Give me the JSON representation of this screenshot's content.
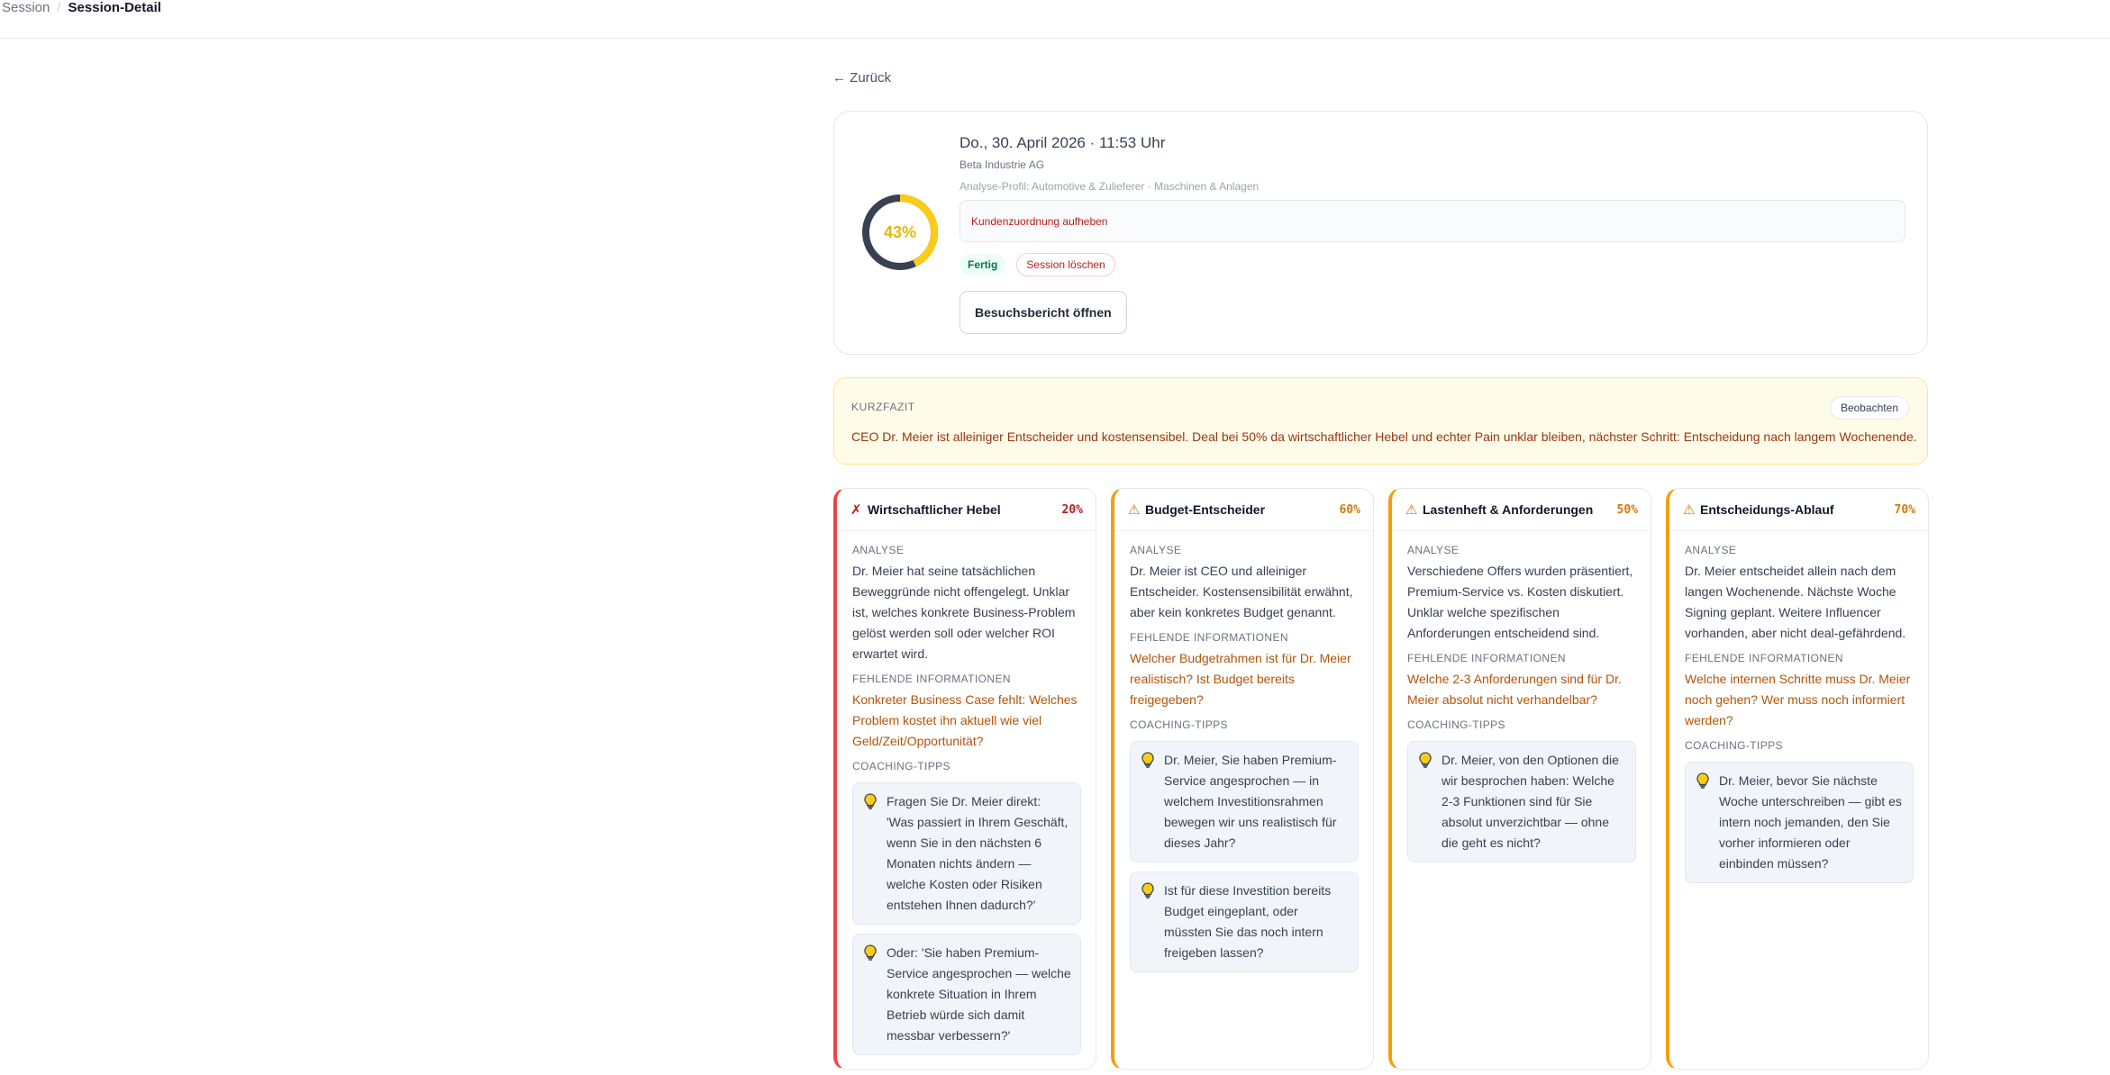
{
  "breadcrumb": {
    "parent": "Session",
    "separator": "/",
    "current": "Session-Detail"
  },
  "back_link": "← Zurück",
  "session": {
    "score_label": "43%",
    "score_value": 43,
    "date": "Do., 30. April 2026 · 11:53 Uhr",
    "customer": "Beta Industrie AG",
    "profile": "Analyse-Profil: Automotive & Zulieferer · Maschinen & Anlagen",
    "unassign_label": "Kundenzuordnung aufheben",
    "status": "Fertig",
    "delete_label": "Session löschen",
    "report_label": "Besuchsbericht öffnen"
  },
  "summary": {
    "title": "KURZFAZIT",
    "badge": "Beobachten",
    "text": "CEO Dr. Meier ist alleiniger Entscheider und kostensensibel. Deal bei 50% da wirtschaftlicher Hebel und echter Pain unklar bleiben, nächster Schritt: Entscheidung nach langem Wochenende."
  },
  "labels": {
    "analysis": "ANALYSE",
    "missing": "FEHLENDE INFORMATIONEN",
    "coaching": "COACHING-TIPPS"
  },
  "columns": [
    {
      "mark": "✗",
      "title": "Wirtschaftlicher Hebel",
      "percent": "20%",
      "analysis": "Dr. Meier hat seine tatsächlichen Beweggründe nicht offengelegt. Unklar ist, welches konkrete Business-Problem gelöst werden soll oder welcher ROI erwartet wird.",
      "missing": "Konkreter Business Case fehlt: Welches Problem kostet ihn aktuell wie viel Geld/Zeit/Opportunität?",
      "tips": [
        "Fragen Sie Dr. Meier direkt: 'Was passiert in Ihrem Geschäft, wenn Sie in den nächsten 6 Monaten nichts ändern — welche Kosten oder Risiken entstehen Ihnen dadurch?'",
        "Oder: 'Sie haben Premium-Service angesprochen — welche konkrete Situation in Ihrem Betrieb würde sich damit messbar verbessern?'"
      ]
    },
    {
      "mark": "⚠",
      "title": "Budget-Entscheider",
      "percent": "60%",
      "analysis": "Dr. Meier ist CEO und alleiniger Entscheider. Kostensensibilität erwähnt, aber kein konkretes Budget genannt.",
      "missing": "Welcher Budgetrahmen ist für Dr. Meier realistisch? Ist Budget bereits freigegeben?",
      "tips": [
        "Dr. Meier, Sie haben Premium-Service angesprochen — in welchem Investitionsrahmen bewegen wir uns realistisch für dieses Jahr?",
        "Ist für diese Investition bereits Budget eingeplant, oder müssten Sie das noch intern freigeben lassen?"
      ]
    },
    {
      "mark": "⚠",
      "title": "Lastenheft & Anforderungen",
      "percent": "50%",
      "analysis": "Verschiedene Offers wurden präsentiert, Premium-Service vs. Kosten diskutiert. Unklar welche spezifischen Anforderungen entscheidend sind.",
      "missing": "Welche 2-3 Anforderungen sind für Dr. Meier absolut nicht verhandelbar?",
      "tips": [
        "Dr. Meier, von den Optionen die wir besprochen haben: Welche 2-3 Funktionen sind für Sie absolut unverzichtbar — ohne die geht es nicht?"
      ]
    },
    {
      "mark": "⚠",
      "title": "Entscheidungs-Ablauf",
      "percent": "70%",
      "analysis": "Dr. Meier entscheidet allein nach dem langen Wochenende. Nächste Woche Signing geplant. Weitere Influencer vorhanden, aber nicht deal-gefährdend.",
      "missing": "Welche internen Schritte muss Dr. Meier noch gehen? Wer muss noch informiert werden?",
      "tips": [
        "Dr. Meier, bevor Sie nächste Woche unterschreiben — gibt es intern noch jemanden, den Sie vorher informieren oder einbinden müssen?"
      ]
    }
  ],
  "colors": {
    "ring_track": "#374151",
    "ring_fill": "#facc15",
    "danger": "#b91c1c",
    "warning": "#d97706",
    "missing_text": "#b45309"
  }
}
